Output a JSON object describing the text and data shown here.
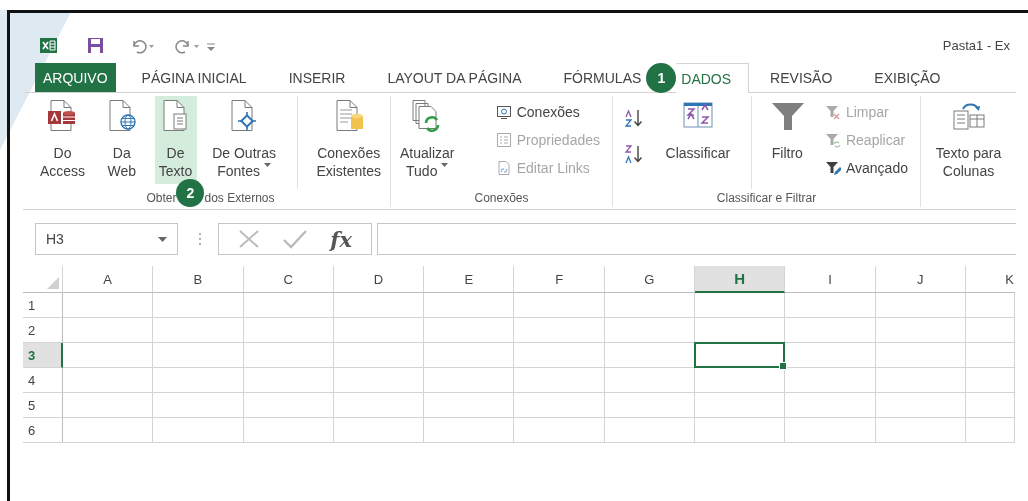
{
  "title_bar": {
    "title": "Pasta1 - Ex"
  },
  "tabs": [
    {
      "label": "ARQUIVO",
      "kind": "file",
      "selected": false
    },
    {
      "label": "PÁGINA INICIAL",
      "kind": "tab",
      "selected": false
    },
    {
      "label": "INSERIR",
      "kind": "tab",
      "selected": false
    },
    {
      "label": "LAYOUT DA PÁGINA",
      "kind": "tab",
      "selected": false
    },
    {
      "label": "FÓRMULAS",
      "kind": "tab",
      "selected": false
    },
    {
      "label": "DADOS",
      "kind": "tab",
      "selected": true,
      "callout": "1"
    },
    {
      "label": "REVISÃO",
      "kind": "tab",
      "selected": false
    },
    {
      "label": "EXIBIÇÃO",
      "kind": "tab",
      "selected": false
    }
  ],
  "ribbon": {
    "groups": [
      {
        "label_parts": [
          "Obter",
          "dos Externos"
        ],
        "callout": "2",
        "items": [
          {
            "kind": "large",
            "lines": [
              "Do",
              "Access"
            ],
            "highlighted": false
          },
          {
            "kind": "large",
            "lines": [
              "Da",
              "Web"
            ],
            "highlighted": false
          },
          {
            "kind": "large",
            "lines": [
              "De",
              "Texto"
            ],
            "highlighted": true
          },
          {
            "kind": "large",
            "lines": [
              "De Outras",
              "Fontes"
            ],
            "dropdown": true,
            "highlighted": false,
            "divider_after": true
          },
          {
            "kind": "large",
            "lines": [
              "Conexões",
              "Existentes"
            ],
            "highlighted": false
          }
        ]
      },
      {
        "label_parts": [
          "Conexões"
        ],
        "items": [
          {
            "kind": "large",
            "lines": [
              "Atualizar",
              "Tudo"
            ],
            "dropdown": true,
            "highlighted": false
          },
          {
            "kind": "stack",
            "buttons": [
              {
                "label": "Conexões",
                "disabled": false
              },
              {
                "label": "Propriedades",
                "disabled": true
              },
              {
                "label": "Editar Links",
                "disabled": true
              }
            ]
          }
        ]
      },
      {
        "label_parts": [
          "Classificar e Filtrar"
        ],
        "items": [
          {
            "kind": "sort",
            "lines": [
              "Classificar"
            ],
            "highlighted": false,
            "divider_after": true
          },
          {
            "kind": "large",
            "lines": [
              "Filtro"
            ],
            "highlighted": false
          },
          {
            "kind": "stack",
            "buttons": [
              {
                "label": "Limpar",
                "disabled": true
              },
              {
                "label": "Reaplicar",
                "disabled": true
              },
              {
                "label": "Avançado",
                "disabled": false
              }
            ]
          }
        ]
      },
      {
        "items": [
          {
            "kind": "large",
            "lines": [
              "Texto para",
              "Colunas"
            ],
            "highlighted": false
          }
        ]
      }
    ]
  },
  "formula_bar": {
    "name_box": "H3",
    "fx_label": "fx"
  },
  "grid": {
    "columns": [
      {
        "label": "A",
        "selected": false
      },
      {
        "label": "B",
        "selected": false
      },
      {
        "label": "C",
        "selected": false
      },
      {
        "label": "D",
        "selected": false
      },
      {
        "label": "E",
        "selected": false
      },
      {
        "label": "F",
        "selected": false
      },
      {
        "label": "G",
        "selected": false
      },
      {
        "label": "H",
        "selected": true
      },
      {
        "label": "I",
        "selected": false
      },
      {
        "label": "J",
        "selected": false
      },
      {
        "label": "K",
        "selected": false
      }
    ],
    "rows": [
      {
        "label": "1",
        "selected": false
      },
      {
        "label": "2",
        "selected": false
      },
      {
        "label": "3",
        "selected": true
      },
      {
        "label": "4",
        "selected": false
      },
      {
        "label": "5",
        "selected": false
      },
      {
        "label": "6",
        "selected": false
      }
    ]
  }
}
